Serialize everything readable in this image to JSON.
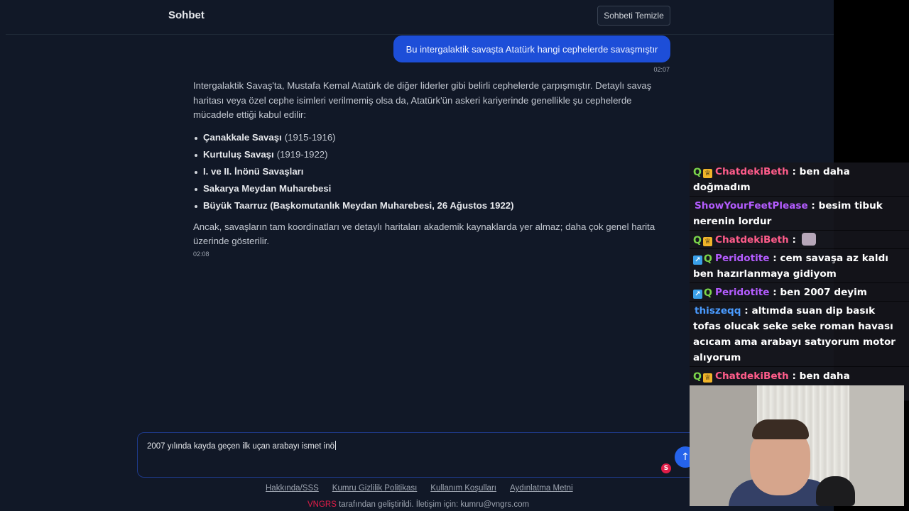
{
  "header": {
    "title": "Sohbet",
    "clear_button": "Sohbeti Temizle"
  },
  "conversation": {
    "user_message": "Bu intergalaktik savaşta Atatürk hangi cephelerde savaşmıştır",
    "user_time": "02:07",
    "assistant_intro": "Intergalaktik Savaş'ta, Mustafa Kemal Atatürk de diğer liderler gibi belirli cephelerde çarpışmıştır. Detaylı savaş haritası veya özel cephe isimleri verilmemiş olsa da, Atatürk'ün askeri kariyerinde genellikle şu cephelerde mücadele ettiği kabul edilir:",
    "fronts": [
      {
        "name": "Çanakkale Savaşı",
        "years": "(1915-1916)"
      },
      {
        "name": "Kurtuluş Savaşı",
        "years": "(1919-1922)"
      },
      {
        "name": "I. ve II. İnönü Savaşları",
        "years": ""
      },
      {
        "name": "Sakarya Meydan Muharebesi",
        "years": ""
      },
      {
        "name": "Büyük Taarruz (Başkomutanlık Meydan Muharebesi, 26 Ağustos 1922)",
        "years": ""
      }
    ],
    "assistant_outro": "Ancak, savaşların tam koordinatları ve detaylı haritaları akademik kaynaklarda yer almaz; daha çok genel harita üzerinde gösterilir.",
    "assistant_time": "02:08"
  },
  "composer": {
    "value": "2007 yılında kayda geçen ilk uçan arabayı ismet inö",
    "send_icon": "arrow-up-icon",
    "grammar_badge": "S"
  },
  "footer": {
    "links": [
      "Hakkında/SSS",
      "Kumru Gizlilik Politikası",
      "Kullanım Koşulları",
      "Aydınlatma Metni"
    ],
    "brand": "VNGRS",
    "credit": "tarafından geliştirildi. İletişim için: kumru@vngrs.com",
    "brand_color": "#e11d48"
  },
  "stream_chat": [
    {
      "user": "ChatdekiBeth",
      "color": "#ff5c8a",
      "badges": [
        "q",
        "crown"
      ],
      "text": "ben daha doğmadım"
    },
    {
      "user": "ShowYourFeetPlease",
      "color": "#b45cff",
      "badges": [],
      "text": "besim tibuk nerenin lordur"
    },
    {
      "user": "ChatdekiBeth",
      "color": "#ff5c8a",
      "badges": [
        "q",
        "crown"
      ],
      "text": "",
      "emote": true
    },
    {
      "user": "Peridotite",
      "color": "#b45cff",
      "badges": [
        "arrow",
        "q"
      ],
      "text": "cem savaşa az kaldı ben hazırlanmaya gidiyom"
    },
    {
      "user": "Peridotite",
      "color": "#b45cff",
      "badges": [
        "arrow",
        "q"
      ],
      "text": "ben 2007 deyim"
    },
    {
      "user": "thiszeqq",
      "color": "#4a9bff",
      "badges": [],
      "text": "altımda suan dip basık tofas olucak seke seke roman havası acıcam ama arabayı satıyorum motor alıyorum"
    },
    {
      "user": "ChatdekiBeth",
      "color": "#ff5c8a",
      "badges": [
        "q",
        "crown"
      ],
      "text": "ben daha doğmadım savaşamam"
    }
  ]
}
